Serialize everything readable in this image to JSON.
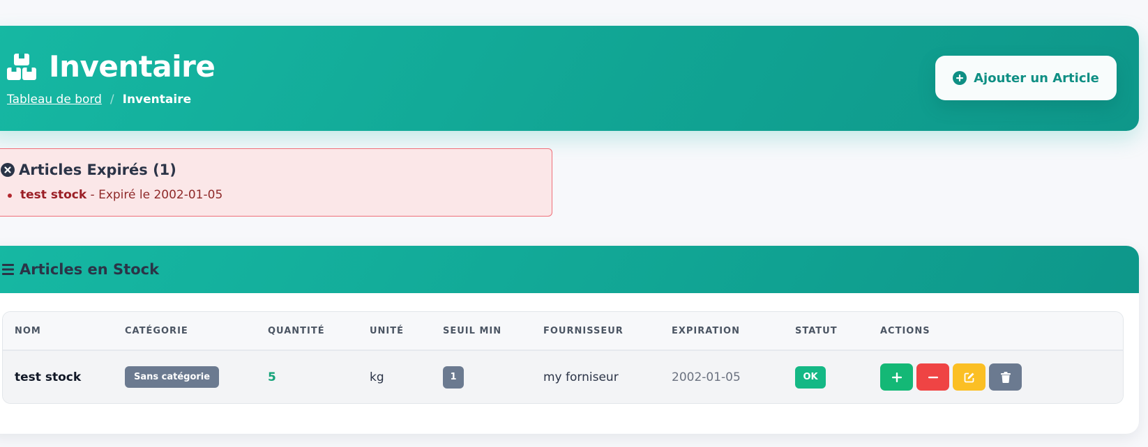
{
  "header": {
    "title": "Inventaire",
    "title_icon": "boxes-icon",
    "breadcrumb": {
      "home": "Tableau de bord",
      "separator": "/",
      "current": "Inventaire"
    },
    "add_button_label": "Ajouter un Article",
    "add_button_icon": "plus-circle-icon"
  },
  "expired_alert": {
    "title": "Articles Expirés (1)",
    "icon": "x-circle-icon",
    "items": [
      {
        "name": "test stock",
        "detail": " - Expiré le 2002-01-05"
      }
    ]
  },
  "stock_card": {
    "title": "Articles en Stock",
    "icon": "list-icon",
    "columns": [
      "NOM",
      "CATÉGORIE",
      "QUANTITÉ",
      "UNITÉ",
      "SEUIL MIN",
      "FOURNISSEUR",
      "EXPIRATION",
      "STATUT",
      "ACTIONS"
    ],
    "rows": [
      {
        "name": "test stock",
        "category": "Sans catégorie",
        "quantity": "5",
        "unit": "kg",
        "min_threshold": "1",
        "supplier": "my forniseur",
        "expiration": "2002-01-05",
        "status": "OK"
      }
    ],
    "actions": [
      "plus-icon",
      "minus-icon",
      "edit-icon",
      "trash-icon"
    ]
  },
  "colors": {
    "brand_teal": "#11a594",
    "alert_bg": "#fbe7e8",
    "alert_border": "#ef6f79",
    "status_ok": "#14b885",
    "btn_add": "#14b876",
    "btn_remove": "#ef4444",
    "btn_edit": "#fbbf24",
    "btn_delete": "#6b7a90"
  }
}
